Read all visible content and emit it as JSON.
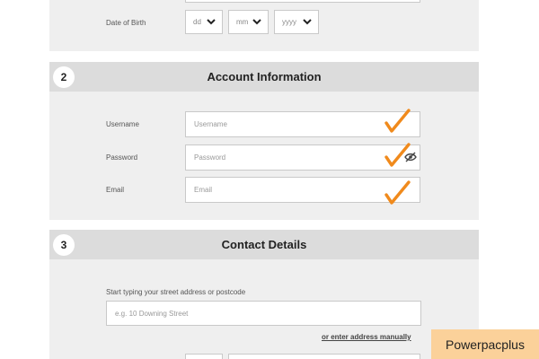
{
  "personal": {
    "dob_label": "Date of Birth",
    "day_value": "dd",
    "month_value": "mm",
    "year_value": "yyyy"
  },
  "account": {
    "step": "2",
    "title": "Account Information",
    "username_label": "Username",
    "username_placeholder": "Username",
    "password_label": "Password",
    "password_placeholder": "Password",
    "email_label": "Email",
    "email_placeholder": "Email"
  },
  "contact": {
    "step": "3",
    "title": "Contact Details",
    "address_label": "Start typing your street address or postcode",
    "address_placeholder": "e.g. 10 Downing Street",
    "manual_link": "or enter address manually"
  },
  "watermark": "Powerpacplus",
  "colors": {
    "checkmark": "#f08a1c"
  }
}
